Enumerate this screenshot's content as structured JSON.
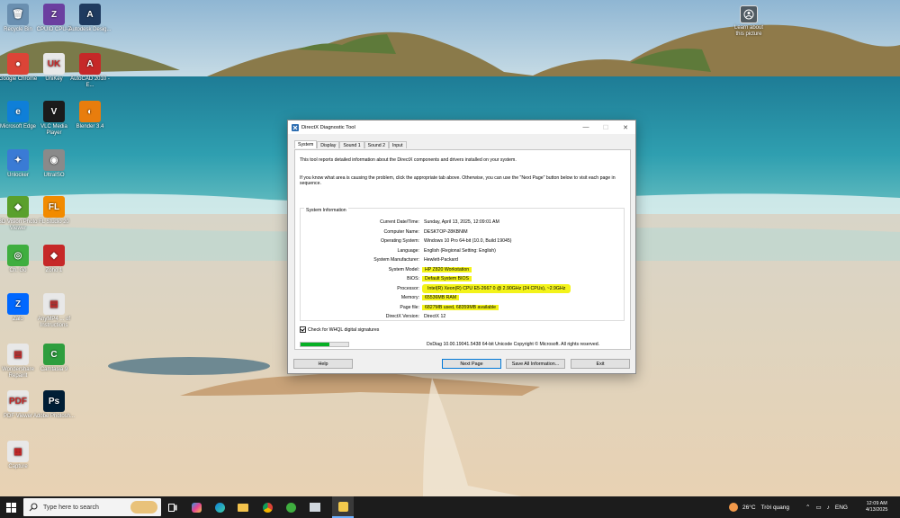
{
  "desktop": {
    "icons": [
      {
        "label": "Recycle Bin",
        "color": "#6a8fb0",
        "glyph": "🗑"
      },
      {
        "label": "Google Chrome",
        "color": "#db4437",
        "glyph": "●"
      },
      {
        "label": "Microsoft Edge",
        "color": "#0f7fd8",
        "glyph": "e"
      },
      {
        "label": "Unlocker",
        "color": "#3a7bd5",
        "glyph": "✦"
      },
      {
        "label": "3D Vision Photo Viewer",
        "color": "#5aa02c",
        "glyph": "◆"
      },
      {
        "label": "Ch. Gồ",
        "color": "#3fae3f",
        "glyph": "◎"
      },
      {
        "label": "Zalo",
        "color": "#0068ff",
        "glyph": "Z"
      },
      {
        "label": "Wondershare Repairit",
        "color": "#e8e8e8",
        "glyph": "▤"
      },
      {
        "label": "PDF Viewer",
        "color": "#e8e8e8",
        "glyph": "PDF"
      },
      {
        "label": "Capture",
        "color": "#e8e8e8",
        "glyph": "▦"
      },
      {
        "label": "CPUID CPU-Z",
        "color": "#6b3fa0",
        "glyph": "Z"
      },
      {
        "label": "UniKey",
        "color": "#e8e8e8",
        "glyph": "UK"
      },
      {
        "label": "VLC Media Player",
        "color": "#1b1b1b",
        "glyph": "V"
      },
      {
        "label": "UltraISO",
        "color": "#8a8a8a",
        "glyph": "◉"
      },
      {
        "label": "FL Studio 20",
        "color": "#f28b00",
        "glyph": "FL"
      },
      {
        "label": "Zoho 1",
        "color": "#c62828",
        "glyph": "◆"
      },
      {
        "label": "AnyMP4 ... of Instructions",
        "color": "#e8e8e8",
        "glyph": "▤"
      },
      {
        "label": "Camtasia 9",
        "color": "#2e9e3e",
        "glyph": "C"
      },
      {
        "label": "Adobe Photosh...",
        "color": "#001e36",
        "glyph": "Ps"
      },
      {
        "label": "Autodesk Desig...",
        "color": "#1f3a5f",
        "glyph": "A"
      },
      {
        "label": "AutoCAD 2010 - E...",
        "color": "#c62828",
        "glyph": "A"
      },
      {
        "label": "Blender 3.4",
        "color": "#e87d0d",
        "glyph": "◐"
      }
    ],
    "about_picture": "Learn about this picture"
  },
  "dialog": {
    "title": "DirectX Diagnostic Tool",
    "window_buttons": {
      "minimize": "—",
      "maximize": "☐",
      "close": "✕"
    },
    "tabs": [
      "System",
      "Display",
      "Sound 1",
      "Sound 2",
      "Input"
    ],
    "active_tab": "System",
    "intro_1": "This tool reports detailed information about the DirectX components and drivers installed on your system.",
    "intro_2": "If you know what area is causing the problem, click the appropriate tab above.  Otherwise, you can use the \"Next Page\" button below to visit each page in sequence.",
    "group_title": "System Information",
    "info_rows": [
      {
        "key": "Current Date/Time:",
        "value": "Sunday, April 13, 2025, 12:09:01 AM"
      },
      {
        "key": "Computer Name:",
        "value": "DESKTOP-28KBNIM"
      },
      {
        "key": "Operating System:",
        "value": "Windows 10 Pro 64-bit (10.0, Build 19045)"
      },
      {
        "key": "Language:",
        "value": "English (Regional Setting: English)"
      },
      {
        "key": "System Manufacturer:",
        "value": "Hewlett-Packard"
      },
      {
        "key": "System Model:",
        "value": "HP Z820 Workstation"
      },
      {
        "key": "BIOS:",
        "value": "Default System BIOS"
      },
      {
        "key": "Processor:",
        "value": "Intel(R) Xeon(R) CPU E5-2667 0 @ 2.90GHz (24 CPUs), ~2.9GHz"
      },
      {
        "key": "Memory:",
        "value": "65536MB RAM"
      },
      {
        "key": "Page file:",
        "value": "6827MB used, 68359MB available"
      },
      {
        "key": "DirectX Version:",
        "value": "DirectX 12"
      }
    ],
    "checkbox_label": "Check for WHQL digital signatures",
    "checkbox_checked": true,
    "progress_fraction": 0.6,
    "copyright": "DxDiag 10.00.19041.5438 64-bit Unicode  Copyright © Microsoft. All rights reserved.",
    "buttons": {
      "help": "Help",
      "next": "Next Page",
      "save": "Save All Information...",
      "exit": "Exit"
    },
    "highlight_color": "#f3f31a"
  },
  "taskbar": {
    "search_placeholder": "Type here to search",
    "weather_temp": "26°C",
    "weather_text": "Trời quang",
    "language": "ENG",
    "time": "12:09 AM",
    "date": "4/13/2025"
  }
}
